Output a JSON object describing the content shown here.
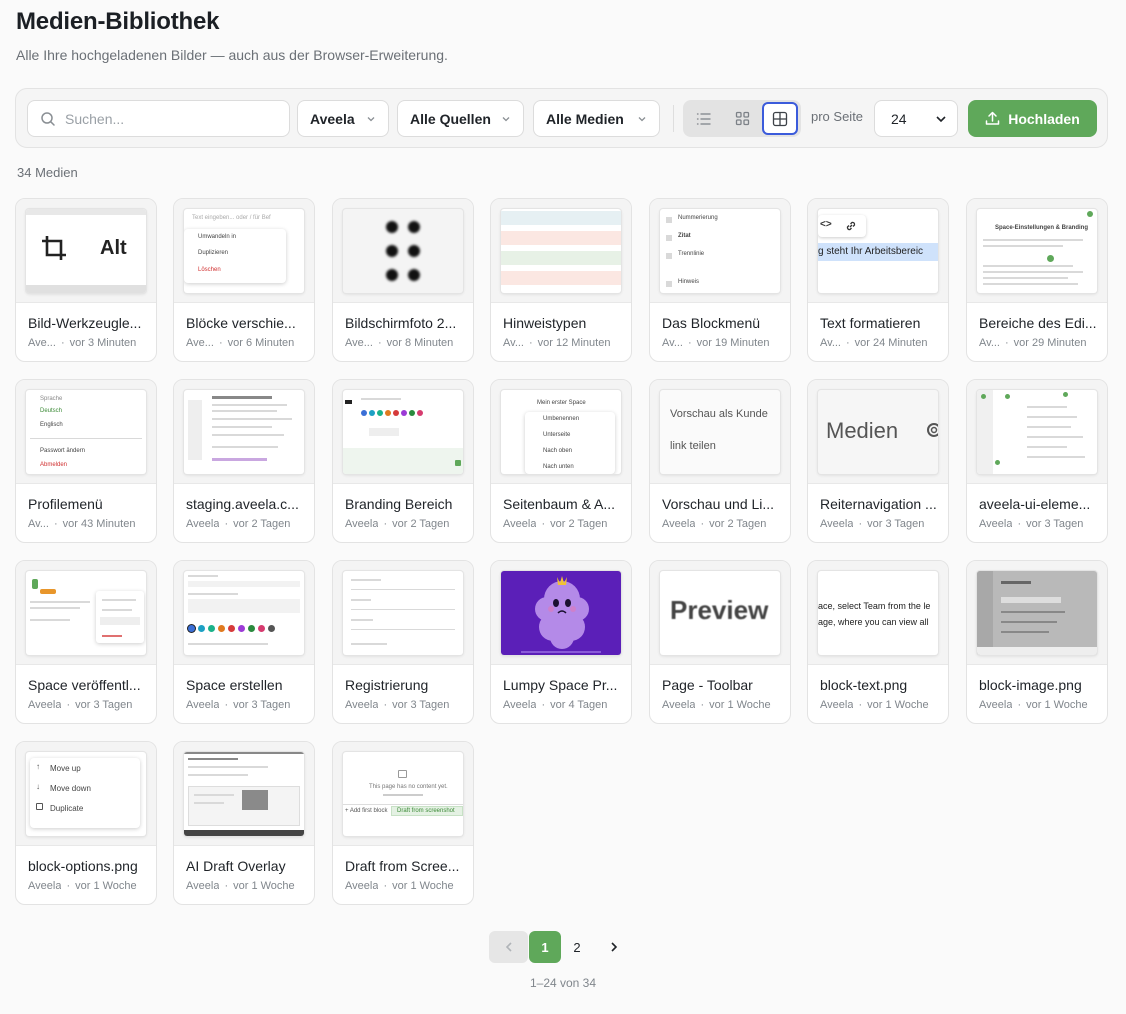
{
  "page": {
    "title": "Medien-Bibliothek",
    "subtitle": "Alle Ihre hochgeladenen Bilder — auch aus der Browser-Erweiterung."
  },
  "toolbar": {
    "search_placeholder": "Suchen...",
    "filter_space": "Aveela",
    "filter_source": "Alle Quellen",
    "filter_media": "Alle Medien",
    "view_modes": [
      "list-view-icon",
      "grid-view-icon",
      "large-grid-view-icon"
    ],
    "active_view": "large-grid-view-icon",
    "per_page_label": "pro Seite",
    "per_page_value": "24",
    "upload_label": "Hochladen"
  },
  "count_label": "34 Medien",
  "media": [
    {
      "name": "Bild-Werkzeugle...",
      "source": "Ave...",
      "time": "vor 3 Minuten"
    },
    {
      "name": "Blöcke verschie...",
      "source": "Ave...",
      "time": "vor 6 Minuten"
    },
    {
      "name": "Bildschirmfoto 2...",
      "source": "Ave...",
      "time": "vor 8 Minuten"
    },
    {
      "name": "Hinweistypen",
      "source": "Av...",
      "time": "vor 12 Minuten"
    },
    {
      "name": "Das Blockmenü",
      "source": "Av...",
      "time": "vor 19 Minuten"
    },
    {
      "name": "Text formatieren",
      "source": "Av...",
      "time": "vor 24 Minuten"
    },
    {
      "name": "Bereiche des Edi...",
      "source": "Av...",
      "time": "vor 29 Minuten"
    },
    {
      "name": "Profilemenü",
      "source": "Av...",
      "time": "vor 43 Minuten"
    },
    {
      "name": "staging.aveela.c...",
      "source": "Aveela",
      "time": "vor 2 Tagen"
    },
    {
      "name": "Branding Bereich",
      "source": "Aveela",
      "time": "vor 2 Tagen"
    },
    {
      "name": "Seitenbaum & A...",
      "source": "Aveela",
      "time": "vor 2 Tagen"
    },
    {
      "name": "Vorschau und Li...",
      "source": "Aveela",
      "time": "vor 2 Tagen"
    },
    {
      "name": "Reiternavigation ...",
      "source": "Aveela",
      "time": "vor 3 Tagen"
    },
    {
      "name": "aveela-ui-eleme...",
      "source": "Aveela",
      "time": "vor 3 Tagen"
    },
    {
      "name": "Space veröffentl...",
      "source": "Aveela",
      "time": "vor 3 Tagen"
    },
    {
      "name": "Space erstellen",
      "source": "Aveela",
      "time": "vor 3 Tagen"
    },
    {
      "name": "Registrierung",
      "source": "Aveela",
      "time": "vor 3 Tagen"
    },
    {
      "name": "Lumpy Space Pr...",
      "source": "Aveela",
      "time": "vor 4 Tagen"
    },
    {
      "name": "Page - Toolbar",
      "source": "Aveela",
      "time": "vor 1 Woche"
    },
    {
      "name": "block-text.png",
      "source": "Aveela",
      "time": "vor 1 Woche"
    },
    {
      "name": "block-image.png",
      "source": "Aveela",
      "time": "vor 1 Woche"
    },
    {
      "name": "block-options.png",
      "source": "Aveela",
      "time": "vor 1 Woche"
    },
    {
      "name": "AI Draft Overlay",
      "source": "Aveela",
      "time": "vor 1 Woche"
    },
    {
      "name": "Draft from Scree...",
      "source": "Aveela",
      "time": "vor 1 Woche"
    }
  ],
  "thumb_text": {
    "t0_alt": "Alt",
    "t1_placeholder": "Text eingeben... oder / für Bef",
    "t1_m1": "Umwandeln in",
    "t1_m2": "Duplizieren",
    "t1_m3": "Löschen",
    "t4_m1": "Nummerierung",
    "t4_m2": "Zitat",
    "t4_m3": "Trennlinie",
    "t4_m4": "Hinweis",
    "t5_text": "g steht Ihr Arbeitsbereic",
    "t6_title": "Space-Einstellungen & Branding",
    "t7_m0": "Sprache",
    "t7_m1": "Deutsch",
    "t7_m2": "Englisch",
    "t7_m3": "Passwort ändern",
    "t7_m4": "Abmelden",
    "t10_m0": "Mein erster Space",
    "t10_m1": "Umbenennen",
    "t10_m2": "Unterseite",
    "t10_m3": "Nach oben",
    "t10_m4": "Nach unten",
    "t11_l1": "Vorschau als Kunde",
    "t11_l2": "link teilen",
    "t12_text": "Medien",
    "t18_text": "Preview",
    "t19_l1": "ace, select Team from the le",
    "t19_l2": "age, where you can view all",
    "t21_m1": "Move up",
    "t21_m2": "Move down",
    "t21_m3": "Duplicate",
    "t23_l1": "This page has no content yet.",
    "t23_b1": "+ Add first block",
    "t23_b2": "Draft from screenshot"
  },
  "colors": {
    "accent_green": "#5fa85a",
    "active_view_border": "#3b5bdb",
    "lumpy_purple": "#5b1fb8"
  },
  "pagination": {
    "pages": [
      "1",
      "2"
    ],
    "current": "1",
    "range_label": "1–24 von 34"
  }
}
